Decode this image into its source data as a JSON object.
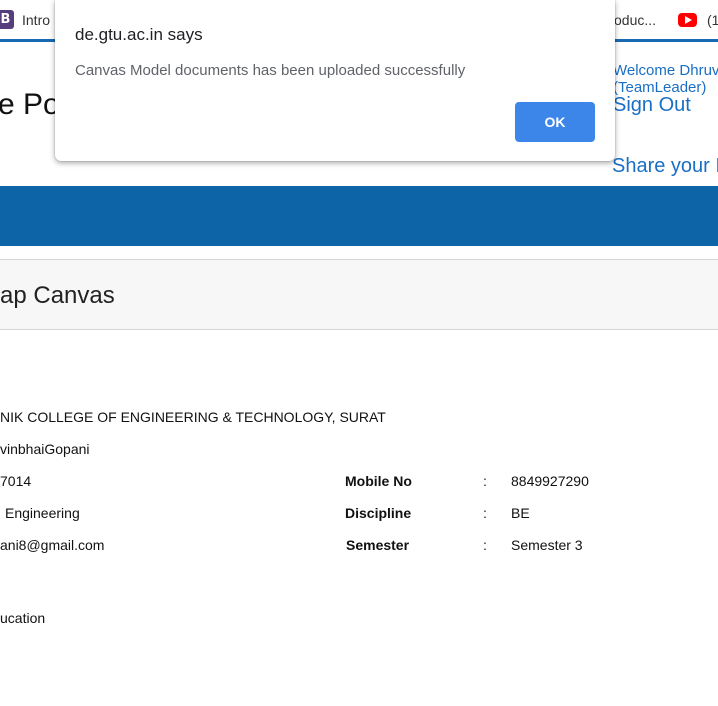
{
  "bookmarks": {
    "items": [
      {
        "label": "Intro",
        "icon": "bootstrap-b-icon"
      },
      {
        "label": "oduc...",
        "icon": "none"
      },
      {
        "label": "(1",
        "icon": "youtube-icon"
      }
    ]
  },
  "header": {
    "portal_title_fragment": "e Po",
    "welcome_line1": "Welcome Dhruv",
    "welcome_line2": "(TeamLeader)",
    "sign_out": "Sign Out",
    "share": "Share your I"
  },
  "page": {
    "section_title": "ap Canvas"
  },
  "details": {
    "college": "NIK COLLEGE OF ENGINEERING & TECHNOLOGY, SURAT",
    "name": "vinbhaiGopani",
    "enrollment_fragment": "7014",
    "branch_fragment": "Engineering",
    "email_fragment": "ani8@gmail.com",
    "education_fragment": "ucation",
    "fields": [
      {
        "label": "Mobile No",
        "value": "8849927290"
      },
      {
        "label": "Discipline",
        "value": "BE"
      },
      {
        "label": "Semester",
        "value": "Semester 3"
      }
    ],
    "separator": ":"
  },
  "dialog": {
    "title": "de.gtu.ac.in says",
    "message": "Canvas Model documents has been uploaded successfully",
    "ok_label": "OK"
  },
  "colors": {
    "accent_blue": "#0d64a7",
    "link_blue": "#1a6fc4",
    "ok_button": "#3c86ea"
  }
}
